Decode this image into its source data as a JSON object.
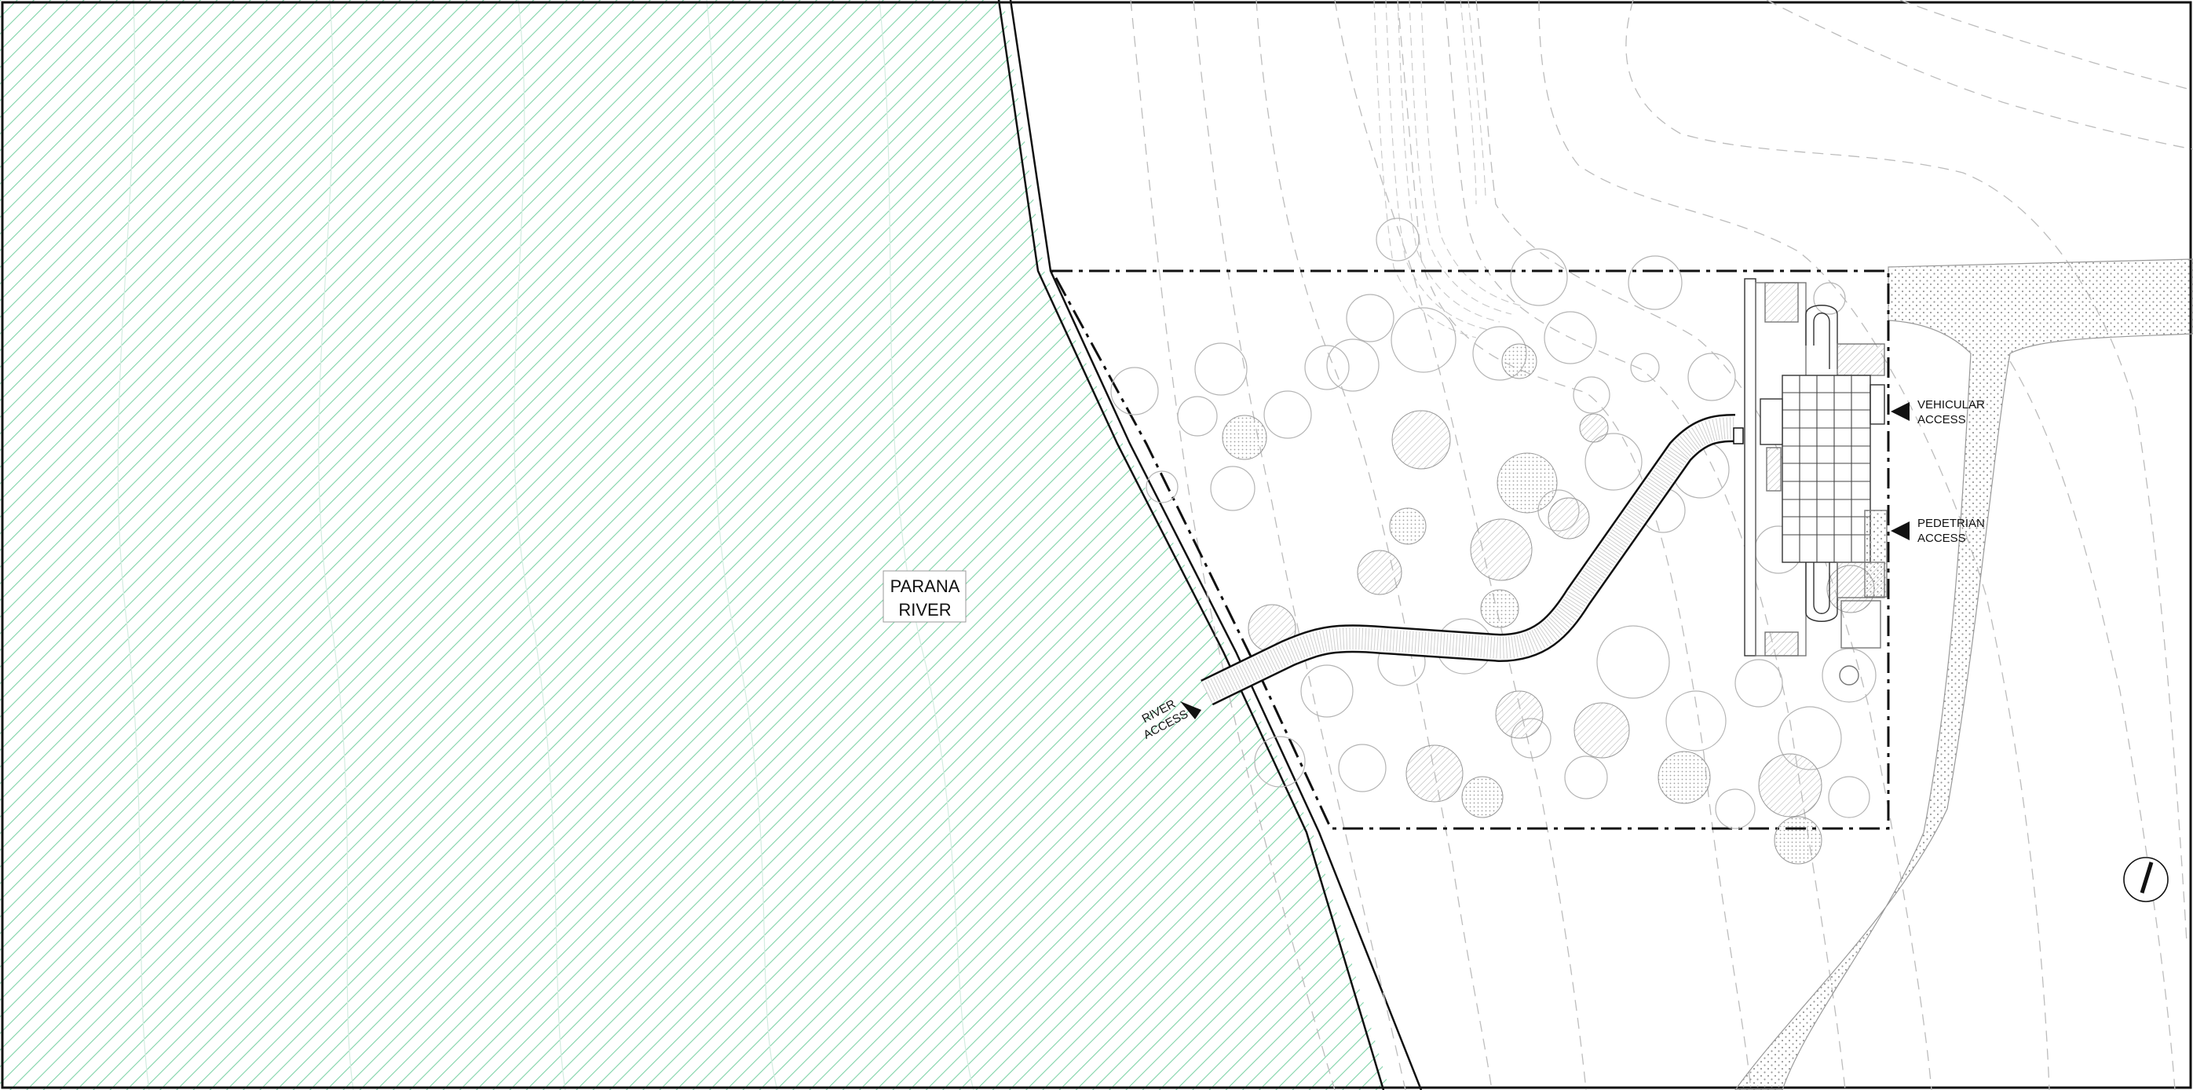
{
  "labels": {
    "river_line1": "PARANA",
    "river_line2": "RIVER",
    "vehicular_line1": "VEHICULAR",
    "vehicular_line2": "ACCESS",
    "pedestrian_line1": "PEDETRIAN",
    "pedestrian_line2": "ACCESS",
    "river_access_line1": "RIVER",
    "river_access_line2": "ACCESS"
  },
  "icons": {
    "north_arrow": "north-arrow-icon",
    "access_marker": "triangle-marker-icon"
  },
  "colors": {
    "river_hatch": "#7fd3a8",
    "linework": "#111111",
    "contours": "#b5b5b5",
    "trees": "#a8a8a8",
    "paving_dots": "#9a9a9a"
  }
}
